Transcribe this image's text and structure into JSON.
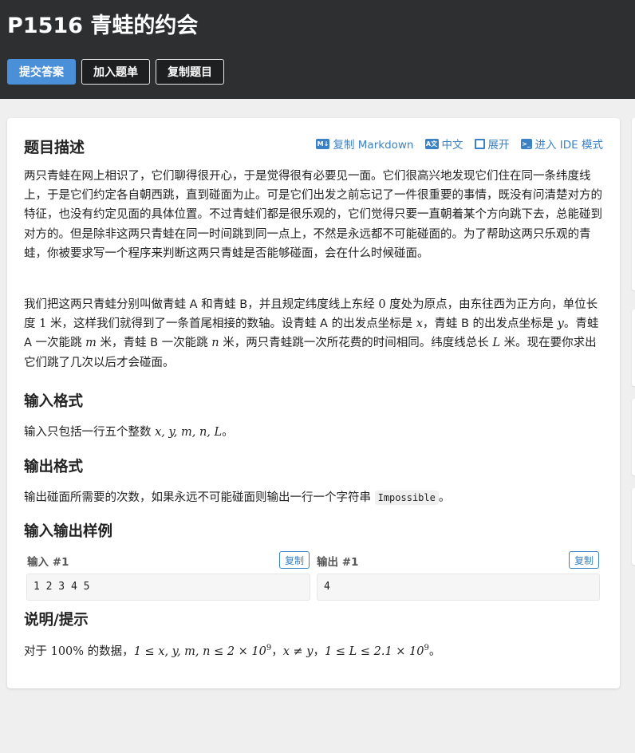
{
  "header": {
    "title": "P1516 青蛙的约会",
    "buttons": {
      "submit": "提交答案",
      "add_to_list": "加入题单",
      "copy_problem": "复制题目"
    }
  },
  "card": {
    "description_heading": "题目描述",
    "toolbar": {
      "copy_markdown": "复制 Markdown",
      "chinese": "中文",
      "expand": "展开",
      "ide_mode": "进入 IDE 模式",
      "icons": [
        "markdown-icon",
        "language-icon",
        "expand-icon",
        "terminal-icon"
      ]
    },
    "description": {
      "p1": "两只青蛙在网上相识了，它们聊得很开心，于是觉得很有必要见一面。它们很高兴地发现它们住在同一条纬度线上，于是它们约定各自朝西跳，直到碰面为止。可是它们出发之前忘记了一件很重要的事情，既没有问清楚对方的特征，也没有约定见面的具体位置。不过青蛙们都是很乐观的，它们觉得只要一直朝着某个方向跳下去，总能碰到对方的。但是除非这两只青蛙在同一时间跳到同一点上，不然是永远都不可能碰面的。为了帮助这两只乐观的青蛙，你被要求写一个程序来判断这两只青蛙是否能够碰面，会在什么时候碰面。",
      "p2": {
        "a": "我们把这两只青蛙分别叫做青蛙 A 和青蛙 B，并且规定纬度线上东经 ",
        "b": "0",
        "c": " 度处为原点，由东往西为正方向，单位长度 ",
        "d": "1",
        "e": " 米，这样我们就得到了一条首尾相接的数轴。设青蛙 A 的出发点坐标是 ",
        "f": "x",
        "g": "，青蛙 B 的出发点坐标是 ",
        "h": "y",
        "i": "。青蛙 A 一次能跳 ",
        "j": "m",
        "k": " 米，青蛙 B 一次能跳 ",
        "l": "n",
        "m": " 米，两只青蛙跳一次所花费的时间相同。纬度线总长 ",
        "n": "L",
        "o": " 米。现在要你求出它们跳了几次以后才会碰面。"
      }
    },
    "input_heading": "输入格式",
    "input_text": {
      "a": "输入只包括一行五个整数 ",
      "math": "x, y, m, n, L",
      "b": "。"
    },
    "output_heading": "输出格式",
    "output_text": {
      "a": "输出碰面所需要的次数，如果永远不可能碰面则输出一行一个字符串 ",
      "code": "Impossible",
      "b": "。"
    },
    "samples_heading": "输入输出样例",
    "samples": {
      "input_label": "输入 #1",
      "output_label": "输出 #1",
      "copy_label": "复制",
      "input_value": "1 2 3 4 5",
      "output_value": "4"
    },
    "hint_heading": "说明/提示",
    "hint": {
      "a": "对于 ",
      "pct": "100%",
      "b": " 的数据，",
      "c1": "1 ≤ x, y, m, n ≤ 2 × 10",
      "c1sup": "9",
      "sep1": "，",
      "c2": "x ≠ y",
      "sep2": "，",
      "c3": "1 ≤ L ≤ 2.1 × 10",
      "c3sup": "9",
      "end": "。"
    }
  }
}
